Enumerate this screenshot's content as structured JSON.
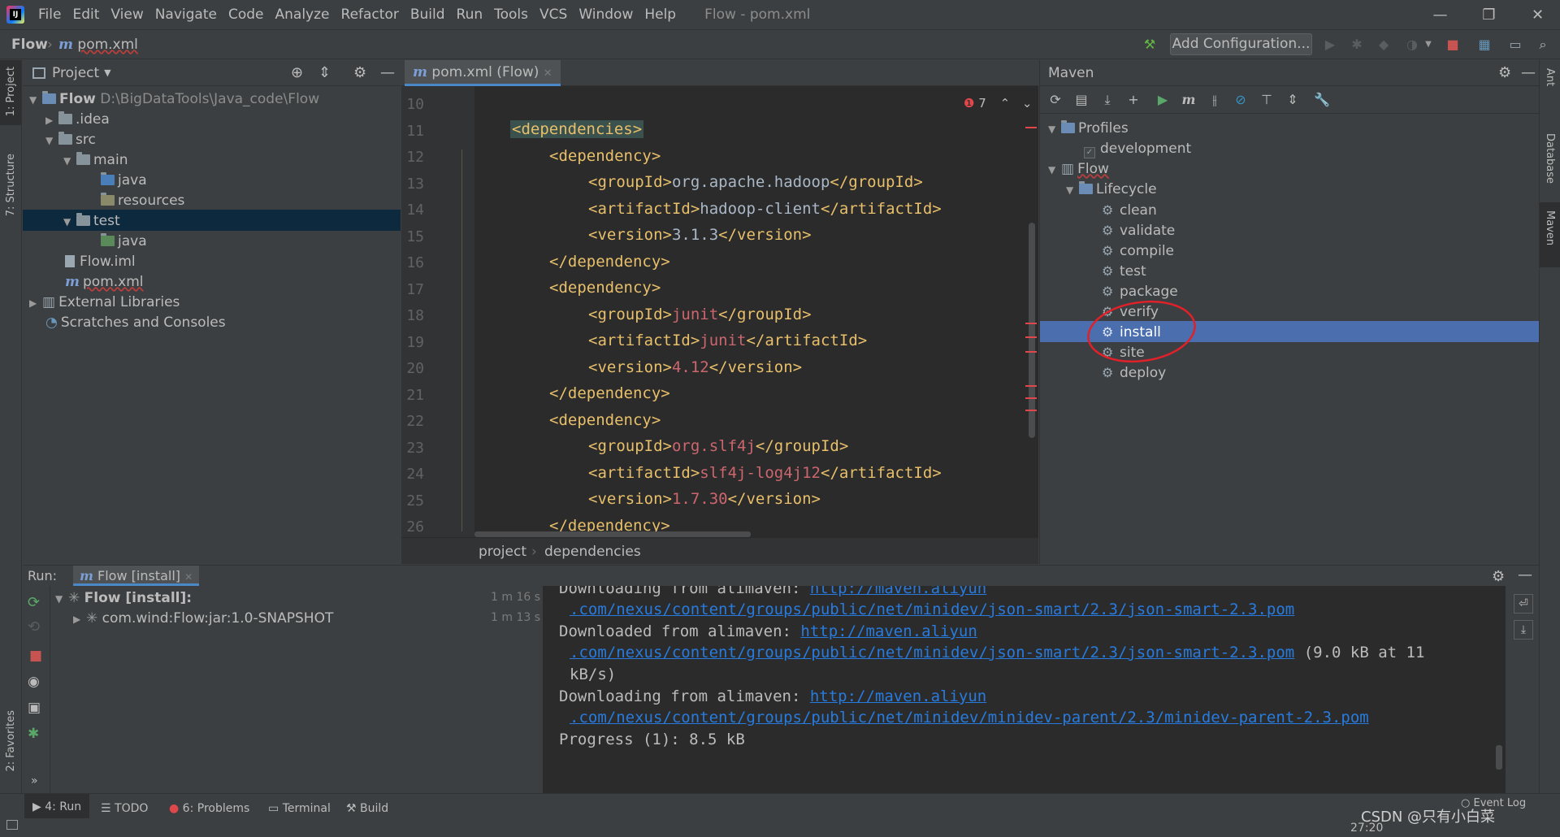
{
  "menu": [
    "File",
    "Edit",
    "View",
    "Navigate",
    "Code",
    "Analyze",
    "Refactor",
    "Build",
    "Run",
    "Tools",
    "VCS",
    "Window",
    "Help"
  ],
  "window_title": "Flow - pom.xml",
  "breadcrumb": {
    "project": "Flow",
    "file": "pom.xml"
  },
  "toolbar": {
    "add_configuration": "Add Configuration..."
  },
  "left_strip": {
    "project": "1: Project",
    "structure": "7: Structure",
    "favorites": "2: Favorites"
  },
  "project_panel": {
    "title": "Project",
    "root_name": "Flow",
    "root_path": "D:\\BigDataTools\\Java_code\\Flow",
    "items": [
      ".idea",
      "src",
      "main",
      "java",
      "resources",
      "test",
      "java",
      "Flow.iml",
      "pom.xml",
      "External Libraries",
      "Scratches and Consoles"
    ]
  },
  "editor": {
    "tab": "pom.xml (Flow)",
    "error_count": "7",
    "line_numbers": [
      "10",
      "11",
      "12",
      "13",
      "14",
      "15",
      "16",
      "17",
      "18",
      "19",
      "20",
      "21",
      "22",
      "23",
      "24",
      "25",
      "26"
    ],
    "lines": {
      "l11": "<dependencies>",
      "l12": "<dependency>",
      "l13a": "<groupId>",
      "l13b": "org.apache.hadoop",
      "l13c": "</groupId>",
      "l14a": "<artifactId>",
      "l14b": "hadoop-client",
      "l14c": "</artifactId>",
      "l15a": "<version>",
      "l15b": "3.1.3",
      "l15c": "</version>",
      "l16": "</dependency>",
      "l17": "<dependency>",
      "l18a": "<groupId>",
      "l18b": "junit",
      "l18c": "</groupId>",
      "l19a": "<artifactId>",
      "l19b": "junit",
      "l19c": "</artifactId>",
      "l20a": "<version>",
      "l20b": "4.12",
      "l20c": "</version>",
      "l21": "</dependency>",
      "l22": "<dependency>",
      "l23a": "<groupId>",
      "l23b": "org.slf4j",
      "l23c": "</groupId>",
      "l24a": "<artifactId>",
      "l24b": "slf4j-log4j12",
      "l24c": "</artifactId>",
      "l25a": "<version>",
      "l25b": "1.7.30",
      "l25c": "</version>",
      "l26": "</dependency>"
    },
    "breadcrumb": [
      "project",
      "dependencies"
    ]
  },
  "maven": {
    "title": "Maven",
    "profiles": "Profiles",
    "profile_development": "development",
    "project": "Flow",
    "lifecycle": "Lifecycle",
    "goals": [
      "clean",
      "validate",
      "compile",
      "test",
      "package",
      "verify",
      "install",
      "site",
      "deploy"
    ],
    "selected": "install"
  },
  "right_strip": {
    "ant": "Ant",
    "database": "Database",
    "maven": "Maven"
  },
  "run_panel": {
    "label": "Run:",
    "tab": "Flow [install]",
    "tree": [
      {
        "name": "Flow [install]:",
        "time": "1 m 16 s"
      },
      {
        "name": "com.wind:Flow:jar:1.0-SNAPSHOT",
        "time": "1 m 13 s"
      }
    ],
    "console": {
      "c1a": "Downloading from alimaven: ",
      "c1b": "http://maven.aliyun",
      "c2": ".com/nexus/content/groups/public/net/minidev/json-smart/2.3/json-smart-2.3.pom",
      "c3a": "Downloaded from alimaven: ",
      "c3b": "http://maven.aliyun",
      "c4a": ".com/nexus/content/groups/public/net/minidev/json-smart/2.3/json-smart-2.3.pom",
      "c4b": " (9.0 kB at 11",
      "c5": "kB/s)",
      "c6a": "Downloading from alimaven: ",
      "c6b": "http://maven.aliyun",
      "c7": ".com/nexus/content/groups/public/net/minidev/minidev-parent/2.3/minidev-parent-2.3.pom",
      "c8": "Progress (1): 8.5 kB"
    }
  },
  "status_tabs": [
    "4: Run",
    "TODO",
    "6: Problems",
    "Terminal",
    "Build"
  ],
  "status_right": {
    "event_log": "Event Log",
    "time": "27:20",
    "watermark": "CSDN @只有小白菜"
  },
  "colors": {
    "selection": "#4b6eaf",
    "annotation": "#e0212a",
    "link": "#287bde",
    "tag": "#e8bf6a"
  }
}
